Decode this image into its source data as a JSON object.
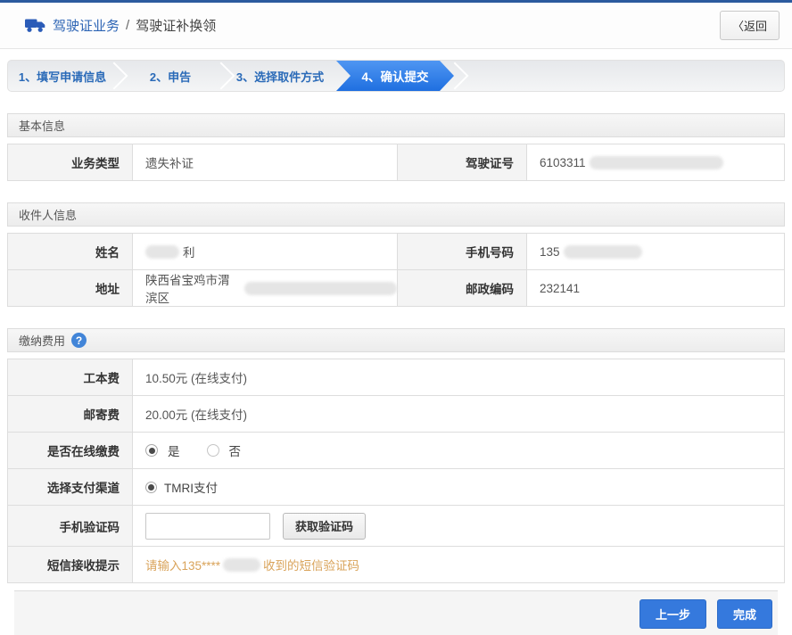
{
  "colors": {
    "accent": "#3579dd",
    "top_border": "#2b5a9e",
    "step_active": "#2e7ce8",
    "warning_text": "#d9a35a"
  },
  "header": {
    "breadcrumb_primary": "驾驶证业务",
    "breadcrumb_separator": "/",
    "breadcrumb_secondary": "驾驶证补换领",
    "back_label": "〈返回"
  },
  "steps": {
    "step1": "1、填写申请信息",
    "step2": "2、申告",
    "step3": "3、选择取件方式",
    "step4": "4、确认提交"
  },
  "basic_info": {
    "title": "基本信息",
    "business_type_label": "业务类型",
    "business_type_value": "遗失补证",
    "license_label": "驾驶证号",
    "license_value_visible": "6103311"
  },
  "recipient_info": {
    "title": "收件人信息",
    "name_label": "姓名",
    "name_value_visible": "利",
    "phone_label": "手机号码",
    "phone_value_visible": "135",
    "address_label": "地址",
    "address_value_visible": "陕西省宝鸡市渭滨区",
    "postcode_label": "邮政编码",
    "postcode_value": "232141"
  },
  "payment": {
    "title": "缴纳费用",
    "help_symbol": "?",
    "work_fee_label": "工本费",
    "work_fee_value": "10.50元 (在线支付)",
    "mail_fee_label": "邮寄费",
    "mail_fee_value": "20.00元 (在线支付)",
    "online_pay_label": "是否在线缴费",
    "online_pay_yes": "是",
    "online_pay_no": "否",
    "channel_label": "选择支付渠道",
    "channel_option": "TMRI支付",
    "captcha_label": "手机验证码",
    "captcha_value": "",
    "captcha_button": "获取验证码",
    "sms_label": "短信接收提示",
    "sms_tip_prefix": "请输入135****",
    "sms_tip_suffix": "收到的短信验证码"
  },
  "footer": {
    "prev_label": "上一步",
    "finish_label": "完成"
  }
}
